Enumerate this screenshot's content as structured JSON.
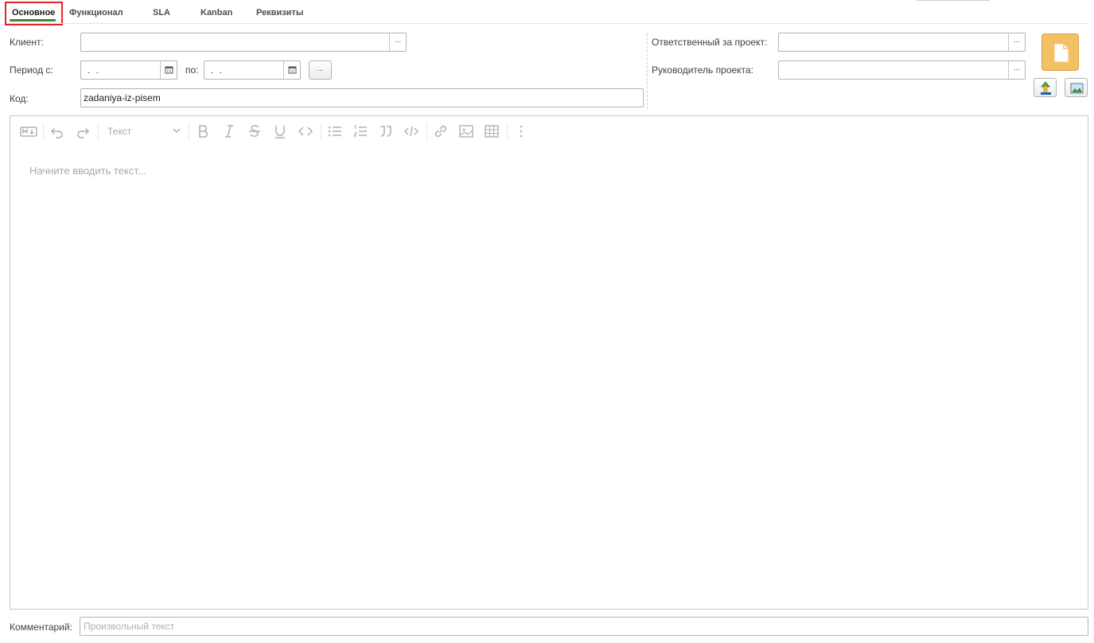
{
  "tabs": [
    {
      "label": "Основное",
      "active": true
    },
    {
      "label": "Функционал",
      "active": false
    },
    {
      "label": "SLA",
      "active": false
    },
    {
      "label": "Kanban",
      "active": false
    },
    {
      "label": "Реквизиты",
      "active": false
    }
  ],
  "form": {
    "client_label": "Клиент:",
    "client_value": "",
    "period_from_label": "Период с:",
    "period_from_value": " .  .",
    "period_to_label": "по:",
    "period_to_value": " .  .",
    "code_label": "Код:",
    "code_value": "zadaniya-iz-pisem",
    "responsible_label": "Ответственный за проект:",
    "responsible_value": "",
    "manager_label": "Руководитель проекта:",
    "manager_value": "",
    "select_button": "...",
    "period_dots": "..."
  },
  "editor": {
    "toolbar": {
      "markdown_icon": "markdown-icon",
      "paragraph_style": "Текст"
    },
    "placeholder": "Начните вводить текст..."
  },
  "comment": {
    "label": "Комментарий:",
    "placeholder": "Произвольный текст",
    "value": ""
  },
  "colors": {
    "accent_green": "#3a8a3a",
    "highlight_red": "#e5242b",
    "picture_button": "#f3c164"
  }
}
